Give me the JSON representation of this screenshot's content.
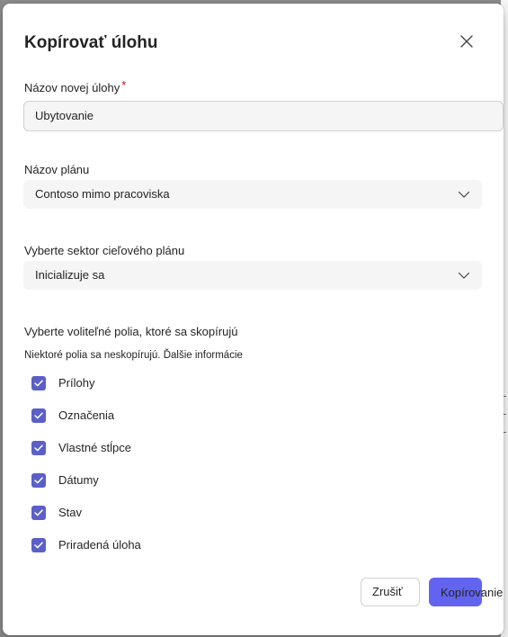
{
  "dialog": {
    "title": "Kopírovať úlohu"
  },
  "task_name": {
    "label": "Názov novej úlohy",
    "required_marker": "*",
    "value": "Ubytovanie"
  },
  "plan_name": {
    "label": "Názov plánu",
    "value": "Contoso mimo pracoviska"
  },
  "bucket": {
    "label": "Vyberte sektor cieľového plánu",
    "value": "Inicializuje sa"
  },
  "optional_fields": {
    "title": "Vyberte voliteľné polia, ktoré sa skopírujú",
    "info": "Niektoré polia sa neskopírujú.",
    "more_link": "Ďalšie informácie",
    "items": [
      {
        "label": "Prílohy",
        "checked": true
      },
      {
        "label": "Označenia",
        "checked": true
      },
      {
        "label": "Vlastné stĺpce",
        "checked": true
      },
      {
        "label": "Dátumy",
        "checked": true
      },
      {
        "label": "Stav",
        "checked": true
      },
      {
        "label": "Priradená úloha",
        "checked": true
      }
    ]
  },
  "buttons": {
    "cancel": "Zrušiť",
    "copy": "Kopírovanie"
  },
  "colors": {
    "accent": "#5b5fc7",
    "primary_button": "#6264f0",
    "required": "#c50f1f",
    "field_background": "#f5f5f5"
  },
  "icons": {
    "close": "close-icon",
    "dropdown": "chevron-down-icon",
    "check": "checkmark-icon"
  }
}
